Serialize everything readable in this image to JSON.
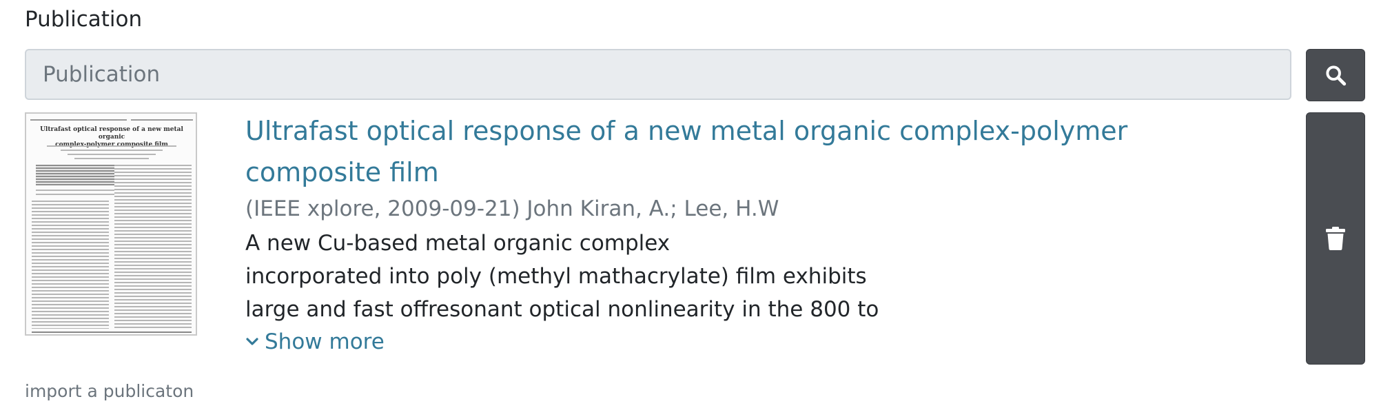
{
  "field": {
    "label": "Publication",
    "placeholder": "Publication",
    "help": "import a publicaton"
  },
  "icons": {
    "search": "search-icon",
    "delete": "trash-icon",
    "expand": "chevron-down-icon"
  },
  "colors": {
    "link": "#337a99",
    "button_bg": "#4a4d52",
    "input_bg": "#e9ecef"
  },
  "publication": {
    "title": "Ultrafast optical response of a new metal organic complex-polymer composite film",
    "meta": "(IEEE xplore, 2009-09-21) John Kiran, A.; Lee, H.W",
    "abstract_lines": [
      "A new Cu-based metal organic complex",
      "incorporated into poly (methyl mathacrylate) film exhibits",
      "large and fast offresonant optical nonlinearity in the 800 to"
    ],
    "show_more": "Show more",
    "thumbnail": {
      "title_line1": "Ultrafast optical response of a new metal organic",
      "title_line2": "complex-polymer composite film"
    }
  }
}
